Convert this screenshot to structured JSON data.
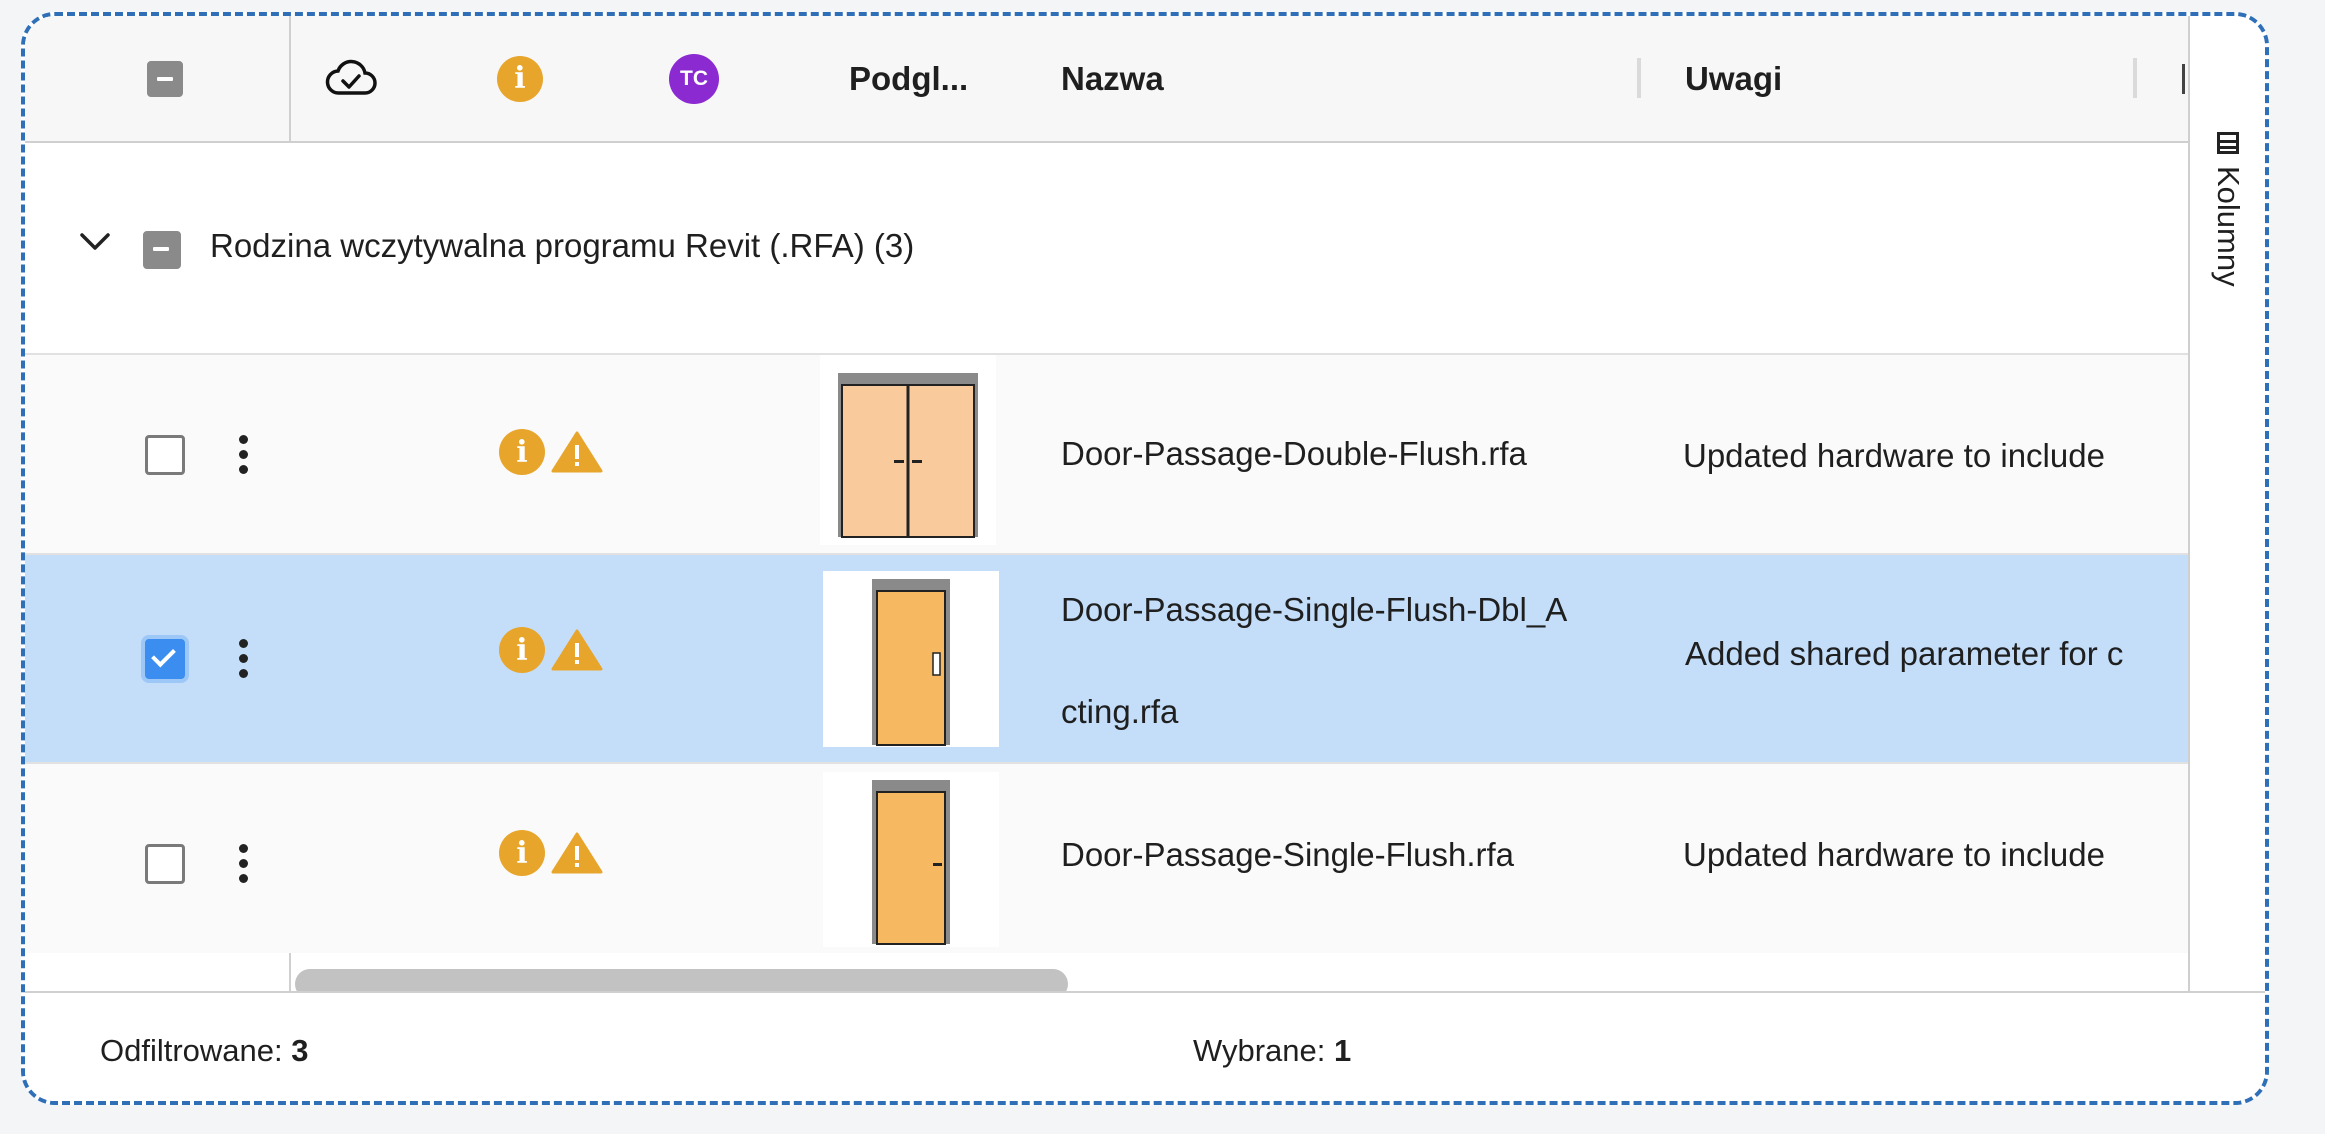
{
  "header": {
    "cloud_icon": "cloud-check-icon",
    "info_icon": "info-icon",
    "info_glyph": "i",
    "badge_initials": "TC",
    "col_preview": "Podgl...",
    "col_name": "Nazwa",
    "col_notes": "Uwagi"
  },
  "group": {
    "label": "Rodzina wczytywalna programu Revit (.RFA) (3)"
  },
  "rows": [
    {
      "name": "Door-Passage-Double-Flush.rfa",
      "notes": "Updated hardware to include",
      "selected": false,
      "info_glyph": "i"
    },
    {
      "name_line1": "Door-Passage-Single-Flush-Dbl_A",
      "name_line2": "cting.rfa",
      "notes": "Added shared parameter for c",
      "selected": true,
      "info_glyph": "i"
    },
    {
      "name": "Door-Passage-Single-Flush.rfa",
      "notes": "Updated hardware to include",
      "selected": false,
      "info_glyph": "i"
    }
  ],
  "footer": {
    "filtered_label": "Odfiltrowane:",
    "filtered_value": "3",
    "selected_label": "Wybrane:",
    "selected_value": "1"
  },
  "side_panel": {
    "columns_label": "Kolumny"
  },
  "colors": {
    "selected_row": "#c4defa",
    "info": "#e7a52b",
    "badge": "#8a2ad0",
    "checkbox_checked": "#3b8df0",
    "frame_dash": "#2f6fb8"
  }
}
